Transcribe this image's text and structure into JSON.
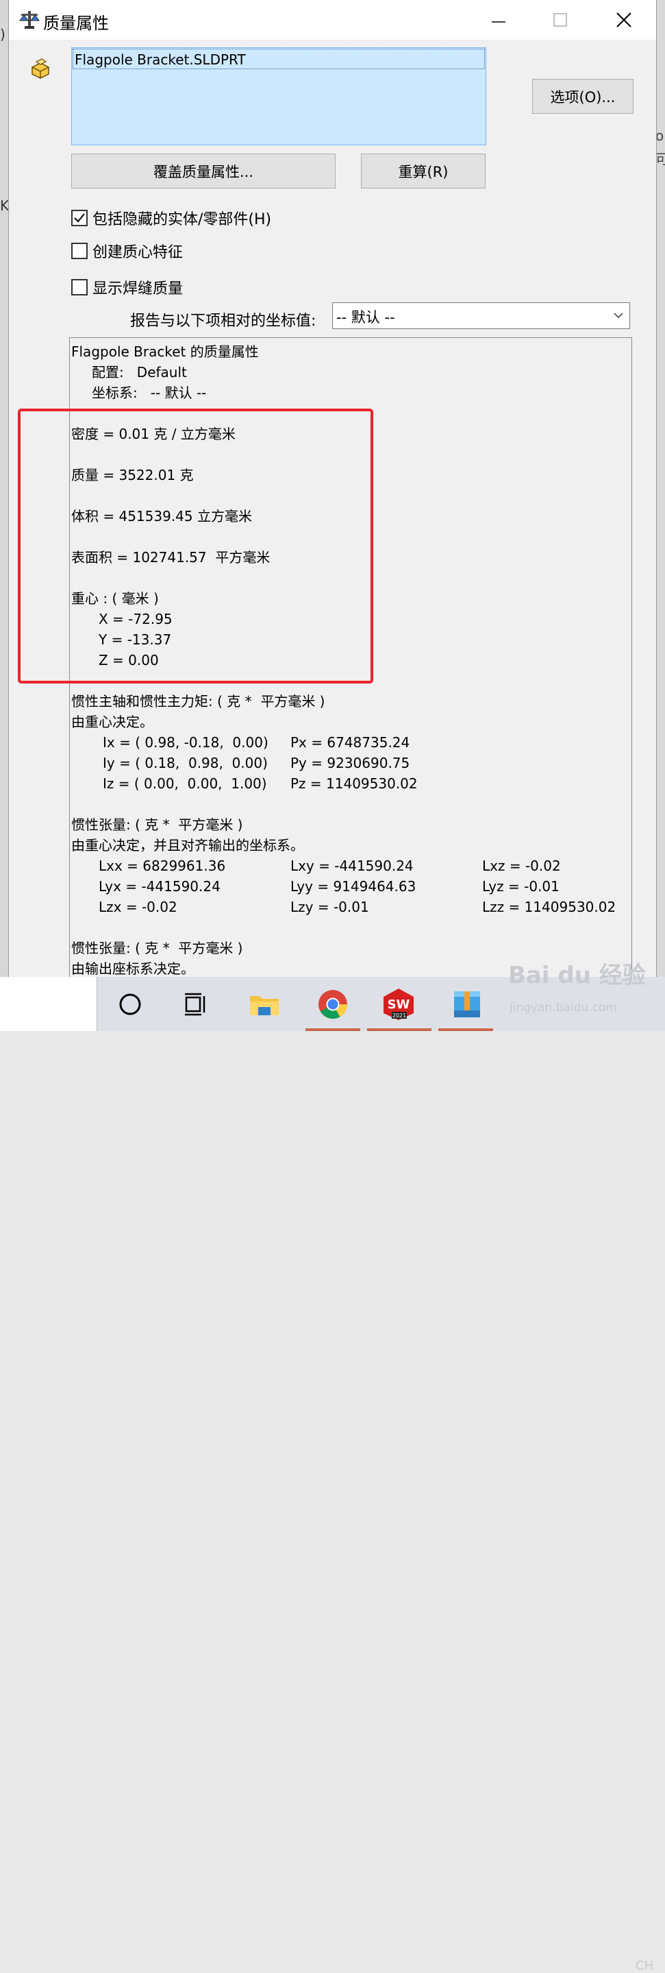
{
  "window": {
    "title": "质量属性"
  },
  "list": {
    "items": [
      "Flagpole Bracket.SLDPRT"
    ]
  },
  "buttons": {
    "options": "选项(O)...",
    "override": "覆盖质量属性...",
    "recalc": "重算(R)"
  },
  "checks": [
    {
      "label": "包括隐藏的实体/零部件(H)",
      "checked": true
    },
    {
      "label": "创建质心特征",
      "checked": false
    },
    {
      "label": "显示焊缝质量",
      "checked": false
    }
  ],
  "coord": {
    "label": "报告与以下项相对的坐标值:",
    "value": "-- 默认 --"
  },
  "results": {
    "header": "Flagpole Bracket 的质量属性",
    "config": "配置:   Default",
    "coordsys": "坐标系:   -- 默认 --",
    "density": "密度 = 0.01 克 / 立方毫米",
    "mass": "质量 = 3522.01 克",
    "volume": "体积 = 451539.45 立方毫米",
    "area": "表面积 = 102741.57  平方毫米",
    "cog_title": "重心 : ( 毫米 )",
    "cog_x": "X = -72.95",
    "cog_y": "Y = -13.37",
    "cog_z": "Z = 0.00",
    "principal_title": "惯性主轴和惯性主力矩: ( 克 *  平方毫米 )",
    "principal_note": "由重心决定。",
    "ix": "Ix = ( 0.98, -0.18,  0.00)",
    "iy": "Iy = ( 0.18,  0.98,  0.00)",
    "iz": "Iz = ( 0.00,  0.00,  1.00)",
    "px": "Px = 6748735.24",
    "py": "Py = 9230690.75",
    "pz": "Pz = 11409530.02",
    "tensor_title": "惯性张量: ( 克 *  平方毫米 )",
    "tensor_note": "由重心决定，并且对齐输出的坐标系。",
    "lxx": "Lxx = 6829961.36",
    "lxy": "Lxy = -441590.24",
    "lxz": "Lxz = -0.02",
    "lyx": "Lyx = -441590.24",
    "lyy": "Lyy = 9149464.63",
    "lyz": "Lyz = -0.01",
    "lzx": "Lzx = -0.02",
    "lzy": "Lzy = -0.01",
    "lzz": "Lzz = 11409530.02",
    "tensor2_title": "惯性张量: ( 克 *  平方毫米 )",
    "tensor2_note": "由输出座标系决定。"
  },
  "background": {
    "left_chars": [
      ")",
      "K"
    ],
    "right_chars": [
      "o",
      "可"
    ]
  },
  "taskbar": {
    "icons": [
      "cortana-icon",
      "task-view-icon",
      "file-explorer-icon",
      "chrome-icon",
      "solidworks-icon",
      "winrar-icon"
    ],
    "sw_label": "SW",
    "sw_year": "2021",
    "ime": "CH"
  },
  "watermark": {
    "main": "Bai du 经验",
    "sub": "jingyan.baidu.com"
  },
  "colors": {
    "highlight": "#e8262a",
    "selection": "#cce8ff"
  }
}
